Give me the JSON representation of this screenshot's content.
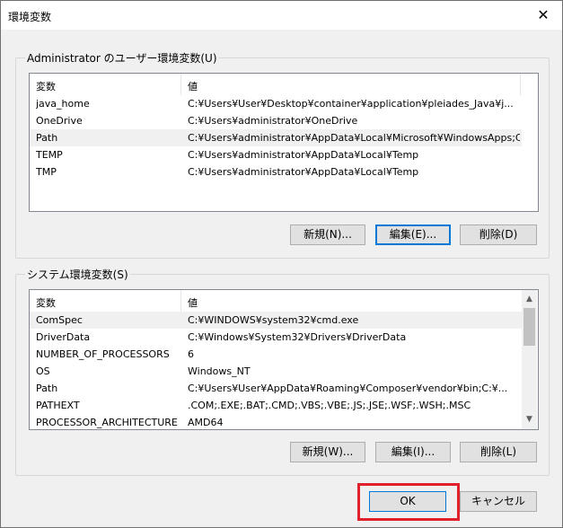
{
  "window": {
    "title": "環境変数",
    "close_glyph": "✕"
  },
  "user_vars": {
    "group_label": "Administrator のユーザー環境変数(U)",
    "columns": [
      "変数",
      "値"
    ],
    "rows": [
      {
        "name": "java_home",
        "value": "C:¥Users¥User¥Desktop¥container¥application¥pleiades_Java¥j..."
      },
      {
        "name": "OneDrive",
        "value": "C:¥Users¥administrator¥OneDrive"
      },
      {
        "name": "Path",
        "value": "C:¥Users¥administrator¥AppData¥Local¥Microsoft¥WindowsApps;C..."
      },
      {
        "name": "TEMP",
        "value": "C:¥Users¥administrator¥AppData¥Local¥Temp"
      },
      {
        "name": "TMP",
        "value": "C:¥Users¥administrator¥AppData¥Local¥Temp"
      }
    ],
    "selected_index": 2,
    "buttons": {
      "new": "新規(N)...",
      "edit": "編集(E)...",
      "delete": "削除(D)"
    }
  },
  "system_vars": {
    "group_label": "システム環境変数(S)",
    "columns": [
      "変数",
      "値"
    ],
    "rows": [
      {
        "name": "ComSpec",
        "value": "C:¥WINDOWS¥system32¥cmd.exe"
      },
      {
        "name": "DriverData",
        "value": "C:¥Windows¥System32¥Drivers¥DriverData"
      },
      {
        "name": "NUMBER_OF_PROCESSORS",
        "value": "6"
      },
      {
        "name": "OS",
        "value": "Windows_NT"
      },
      {
        "name": "Path",
        "value": "C:¥Users¥User¥AppData¥Roaming¥Composer¥vendor¥bin;C:¥..."
      },
      {
        "name": "PATHEXT",
        "value": ".COM;.EXE;.BAT;.CMD;.VBS;.VBE;.JS;.JSE;.WSF;.WSH;.MSC"
      },
      {
        "name": "PROCESSOR_ARCHITECTURE",
        "value": "AMD64"
      }
    ],
    "selected_index": 0,
    "buttons": {
      "new": "新規(W)...",
      "edit": "編集(I)...",
      "delete": "削除(L)"
    }
  },
  "footer": {
    "ok": "OK",
    "cancel": "キャンセル"
  },
  "colors": {
    "highlight": "#e0202a",
    "focus": "#0078d7"
  },
  "icons": {
    "scroll_up": "▲",
    "scroll_down": "▼"
  }
}
